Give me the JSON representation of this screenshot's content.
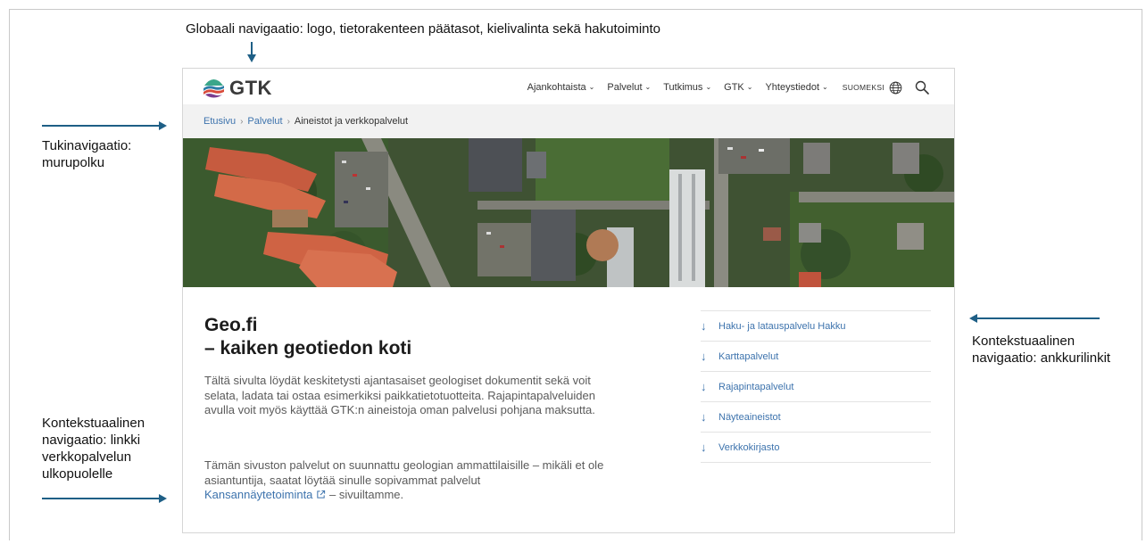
{
  "annotations": {
    "global_nav": "Globaali navigaatio: logo, tietorakenteen päätasot, kielivalinta sekä hakutoiminto",
    "breadcrumb_nav_line1": "Tukinavigaatio:",
    "breadcrumb_nav_line2": "murupolku",
    "external_nav_line1": "Kontekstuaalinen",
    "external_nav_line2": "navigaatio: linkki",
    "external_nav_line3": "verkkopalvelun",
    "external_nav_line4": "ulkopuolelle",
    "anchor_nav_line1": "Kontekstuaalinen",
    "anchor_nav_line2": "navigaatio: ankkurilinkit"
  },
  "site": {
    "logo_text": "GTK",
    "menu": [
      {
        "label": "Ajankohtaista"
      },
      {
        "label": "Palvelut"
      },
      {
        "label": "Tutkimus"
      },
      {
        "label": "GTK"
      },
      {
        "label": "Yhteystiedot"
      }
    ],
    "language": "SUOMEKSI",
    "breadcrumb": {
      "home": "Etusivu",
      "section": "Palvelut",
      "current": "Aineistot ja verkkopalvelut"
    },
    "heading_line1": "Geo.fi",
    "heading_line2": "– kaiken geotiedon koti",
    "paragraph1": "Tältä sivulta löydät keskitetysti ajantasaiset geologiset dokumentit sekä voit selata, ladata tai ostaa esimerkiksi paikkatietotuotteita. Rajapintapalveluiden avulla voit myös käyttää GTK:n aineistoja oman palvelusi pohjana maksutta.",
    "paragraph2_start": "Tämän sivuston palvelut on suunnattu geologian ammattilaisille – mikäli et ole asiantuntija, saatat löytää sinulle sopivammat palvelut",
    "paragraph2_link": "Kansannäytetoiminta",
    "paragraph2_end": "– sivuiltamme.",
    "anchors": [
      {
        "label": "Haku- ja latauspalvelu Hakku"
      },
      {
        "label": "Karttapalvelut"
      },
      {
        "label": "Rajapintapalvelut"
      },
      {
        "label": "Näyteaineistot"
      },
      {
        "label": "Verkkokirjasto"
      }
    ],
    "icons": {
      "chevron": "chevron-down-icon",
      "globe": "globe-icon",
      "search": "search-icon",
      "anchor": "arrow-down-icon",
      "external": "external-link-icon"
    },
    "colors": {
      "link": "#3d73ad",
      "annotation_arrow": "#1e5f86",
      "breadcrumb_bg": "#f2f2f2"
    }
  }
}
